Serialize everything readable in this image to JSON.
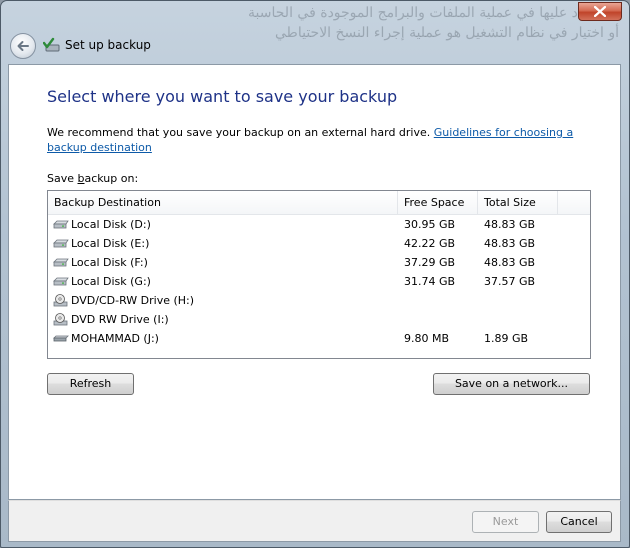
{
  "background_text": {
    "line1": "بالإعتماد عليها في عملية الملفات والبرامج الموجودة في الحاسبة",
    "line2": "أو اختيار في نظام التشغيل هو عملية إجراء النسخ الاحتياطي"
  },
  "titlebar": {
    "title": "Set up backup",
    "close_icon": "close-icon",
    "back_icon": "back-arrow-icon",
    "app_icon": "backup-icon"
  },
  "main": {
    "heading": "Select where you want to save your backup",
    "recommend_text": "We recommend that you save your backup on an external hard drive. ",
    "guidelines_link": "Guidelines for choosing a backup destination",
    "save_label_prefix": "Save ",
    "save_label_accel": "b",
    "save_label_suffix": "ackup on:"
  },
  "list": {
    "columns": [
      "Backup Destination",
      "Free Space",
      "Total Size"
    ],
    "rows": [
      {
        "name": "Local Disk (D:)",
        "free": "30.95 GB",
        "total": "48.83 GB",
        "icon": "hard-disk-icon"
      },
      {
        "name": "Local Disk (E:)",
        "free": "42.22 GB",
        "total": "48.83 GB",
        "icon": "hard-disk-icon"
      },
      {
        "name": "Local Disk (F:)",
        "free": "37.29 GB",
        "total": "48.83 GB",
        "icon": "hard-disk-icon"
      },
      {
        "name": "Local Disk (G:)",
        "free": "31.74 GB",
        "total": "37.57 GB",
        "icon": "hard-disk-icon"
      },
      {
        "name": "DVD/CD-RW Drive (H:)",
        "free": "",
        "total": "",
        "icon": "dvd-drive-icon"
      },
      {
        "name": "DVD RW Drive (I:)",
        "free": "",
        "total": "",
        "icon": "dvd-drive-icon"
      },
      {
        "name": "MOHAMMAD (J:)",
        "free": "9.80 MB",
        "total": "1.89 GB",
        "icon": "removable-drive-icon"
      }
    ]
  },
  "buttons": {
    "refresh": "Refresh",
    "save_network": "Save on a network...",
    "next": "Next",
    "cancel": "Cancel"
  },
  "colors": {
    "heading": "#1e3287",
    "link": "#0d5aa8",
    "close_button": "#c0442a"
  }
}
